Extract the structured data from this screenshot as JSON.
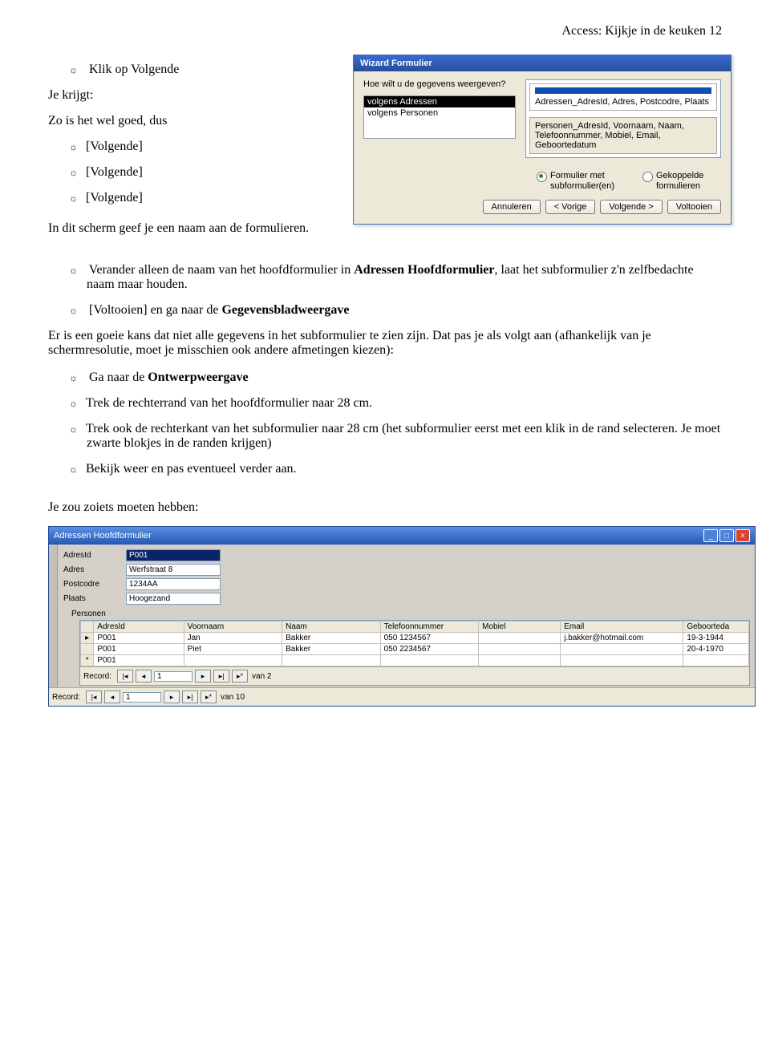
{
  "header": "Access:  Kijkje in de keuken  12",
  "intro": {
    "i1": "Klik op Volgende",
    "i2": "Je krijgt:",
    "i3": "Zo is het wel goed, dus",
    "v1": "[Volgende]",
    "v2": "[Volgende]",
    "v3": "[Volgende]",
    "i4": "In dit scherm geef je een naam aan de formulieren."
  },
  "wizard": {
    "title": "Wizard Formulier",
    "question": "Hoe wilt u de gegevens weergeven?",
    "opt1": "volgens Adressen",
    "opt2": "volgens Personen",
    "previewTopText": "Adressen_AdresId, Adres, Postcodre, Plaats",
    "previewBotText": "Personen_AdresId, Voornaam, Naam, Telefoonnummer, Mobiel, Email, Geboortedatum",
    "radio1": "Formulier met subformulier(en)",
    "radio2": "Gekoppelde formulieren",
    "btn_cancel": "Annuleren",
    "btn_back": "< Vorige",
    "btn_next": "Volgende >",
    "btn_finish": "Voltooien"
  },
  "steps": {
    "s1a": "Verander alleen de naam van het hoofdformulier in ",
    "s1b": "Adressen Hoofdformulier",
    "s1c": ", laat het subformulier z'n zelfbedachte naam maar houden.",
    "s2a": "[Voltooien]",
    "s2b": "  en ga naar de ",
    "s2c": "Gegevensbladweergave",
    "body3": "Er is een goeie kans dat niet alle gegevens in het subformulier te zien zijn. Dat pas je als volgt aan (afhankelijk van je schermresolutie, moet je misschien ook andere afmetingen kiezen):",
    "s4a": "Ga naar de ",
    "s4b": "Ontwerpweergave",
    "s5": "Trek de rechterrand van het hoofdformulier naar 28 cm.",
    "s6": "Trek ook de rechterkant van het subformulier naar 28 cm (het subformulier eerst met een klik in de rand selecteren. Je moet zwarte blokjes in de randen krijgen)",
    "s7": "Bekijk weer en pas eventueel verder aan."
  },
  "closing": "Je zou zoiets moeten hebben:",
  "form": {
    "title": "Adressen Hoofdformulier",
    "labels": {
      "adresid": "AdresId",
      "adres": "Adres",
      "postcode": "Postcodre",
      "plaats": "Plaats",
      "personen": "Personen"
    },
    "values": {
      "adresid": "P001",
      "adres": "Werfstraat 8",
      "postcode": "1234AA",
      "plaats": "Hoogezand"
    },
    "cols": {
      "c1": "AdresId",
      "c2": "Voornaam",
      "c3": "Naam",
      "c4": "Telefoonnummer",
      "c5": "Mobiel",
      "c6": "Email",
      "c7": "Geboorteda"
    },
    "rows": [
      {
        "adresid": "P001",
        "voornaam": "Jan",
        "naam": "Bakker",
        "tel": "050 1234567",
        "mobiel": "",
        "email": "j.bakker@hotmail.com",
        "geb": "19-3-1944"
      },
      {
        "adresid": "P001",
        "voornaam": "Piet",
        "naam": "Bakker",
        "tel": "050 2234567",
        "mobiel": "",
        "email": "",
        "geb": "20-4-1970"
      },
      {
        "adresid": "P001",
        "voornaam": "",
        "naam": "",
        "tel": "",
        "mobiel": "",
        "email": "",
        "geb": ""
      }
    ],
    "recnav_label": "Record:",
    "recnav_inner_cur": "1",
    "recnav_inner_of": "van  2",
    "recnav_outer_cur": "1",
    "recnav_outer_of": "van  10"
  }
}
